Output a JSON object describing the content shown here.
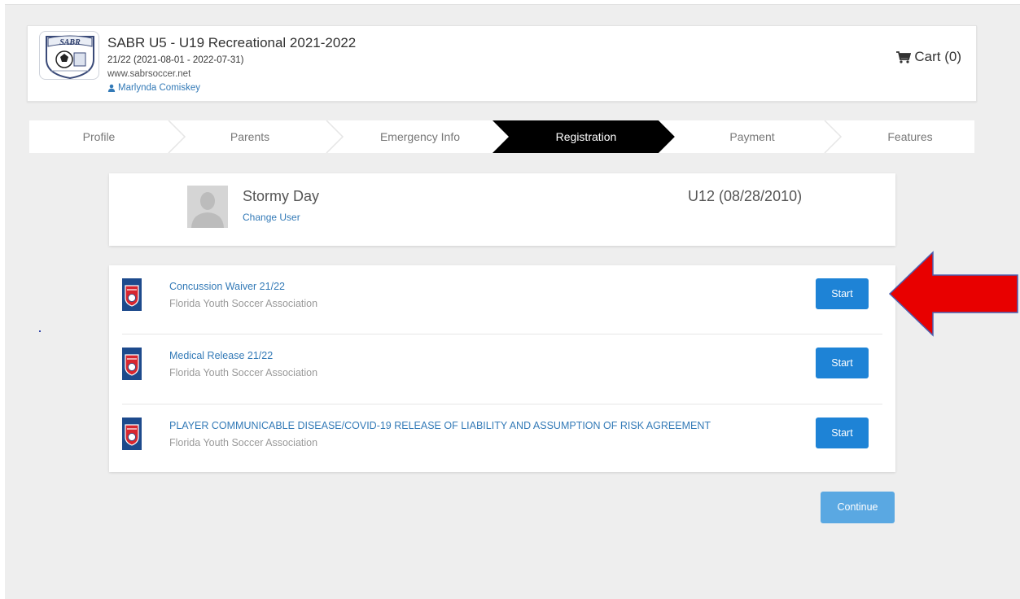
{
  "header": {
    "org_title": "SABR U5 - U19 Recreational 2021-2022",
    "season": "21/22 (2021-08-01 - 2022-07-31)",
    "website": "www.sabrsoccer.net",
    "user_name": "Marlynda Comiskey",
    "cart_label": "Cart (0)",
    "logo_text": "SABR"
  },
  "steps": [
    {
      "label": "Profile",
      "active": false
    },
    {
      "label": "Parents",
      "active": false
    },
    {
      "label": "Emergency Info",
      "active": false
    },
    {
      "label": "Registration",
      "active": true
    },
    {
      "label": "Payment",
      "active": false
    },
    {
      "label": "Features",
      "active": false
    }
  ],
  "player": {
    "name": "Stormy Day",
    "change_user": "Change User",
    "age_group": "U12 (08/28/2010)"
  },
  "forms": [
    {
      "title": "Concussion Waiver 21/22",
      "org": "Florida Youth Soccer Association",
      "button": "Start"
    },
    {
      "title": "Medical Release 21/22",
      "org": "Florida Youth Soccer Association",
      "button": "Start"
    },
    {
      "title": "PLAYER COMMUNICABLE DISEASE/COVID-19 RELEASE OF LIABILITY AND ASSUMPTION OF RISK AGREEMENT",
      "org": "Florida Youth Soccer Association",
      "button": "Start"
    }
  ],
  "continue_label": "Continue",
  "colors": {
    "link": "#337ab7",
    "primary_button": "#1e83d6",
    "continue_button": "#5aa8e2",
    "active_step": "#000000",
    "annotation_arrow": "#e80000"
  },
  "icons": {
    "cart": "cart-icon",
    "user": "user-icon",
    "form_logo": "fysa-crest-icon",
    "annotation": "red-arrow-icon"
  }
}
